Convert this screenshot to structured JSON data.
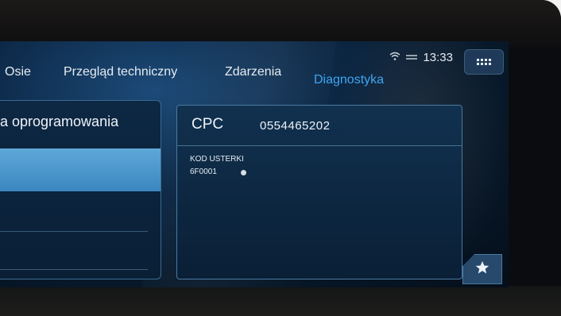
{
  "nav": {
    "tabs": [
      {
        "label": "Osie",
        "active": false
      },
      {
        "label": "Przegląd techniczny",
        "active": false
      },
      {
        "label": "Zdarzenia",
        "active": false
      },
      {
        "label": "Diagnostyka",
        "active": true
      }
    ]
  },
  "status": {
    "time": "13:33",
    "wifi_icon": "wifi-icon",
    "link_icon": "connection-icon"
  },
  "menu": {
    "icon": "app-grid-icon"
  },
  "left_panel": {
    "title": "a oprogramowania"
  },
  "right_panel": {
    "cpc_label": "CPC",
    "cpc_value": "0554465202",
    "fault_code_label": "KOD USTERKI",
    "fault_code_value": "6F0001"
  },
  "favorite": {
    "icon": "star-icon"
  },
  "colors": {
    "accent": "#3fa6f0",
    "text": "#e6ecf2",
    "panel_border": "#4a7aa0"
  }
}
